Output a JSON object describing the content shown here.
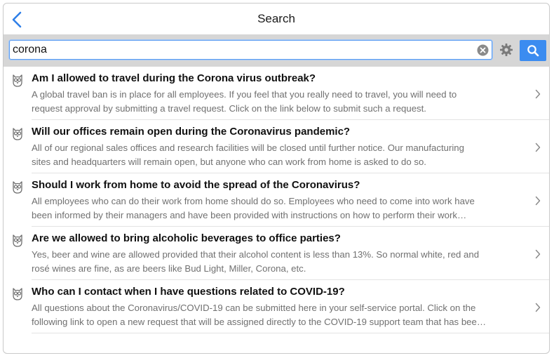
{
  "header": {
    "title": "Search"
  },
  "search": {
    "query": "corona"
  },
  "results": [
    {
      "title": "Am I allowed to travel during the Corona virus outbreak?",
      "line1": "A global travel ban is in place for all employees. If you feel that you really need to travel, you will need to",
      "line2": "request approval by submitting a travel request. Click on the link below to submit such a request."
    },
    {
      "title": "Will our offices remain open during the Coronavirus pandemic?",
      "line1": "All of our regional sales offices and research facilities will be closed until further notice. Our manufacturing",
      "line2": "sites and headquarters will remain open, but anyone who can work from home is asked to do so."
    },
    {
      "title": "Should I work from home to avoid the spread of the Coronavirus?",
      "line1": "All employees who can do their work from home should do so. Employees who need to come into work have",
      "line2": "been informed by their managers and have been provided with instructions on how to perform their work…"
    },
    {
      "title": "Are we allowed to bring alcoholic beverages to office parties?",
      "line1": "Yes, beer and wine are allowed provided that their alcohol content is less than 13%. So normal white, red and",
      "line2": "rosé wines are fine, as are beers like Bud Light, Miller, Corona, etc."
    },
    {
      "title": "Who can I contact when I have questions related to COVID-19?",
      "line1": "All questions about the Coronavirus/COVID-19 can be submitted here in your self-service portal. Click on the",
      "line2": "following link to open a new request that will be assigned directly to the COVID-19 support team that has bee…"
    }
  ],
  "icons": {
    "back": "chevron-left-icon",
    "clear": "clear-circle-icon",
    "settings": "gear-icon",
    "search": "magnifier-icon",
    "result": "owl-icon",
    "result_arrow": "chevron-right-icon"
  },
  "colors": {
    "accent": "#3b8cf0",
    "search_bar_bg": "#d6d6d6",
    "snippet_text": "#707070",
    "title_text": "#111111"
  }
}
